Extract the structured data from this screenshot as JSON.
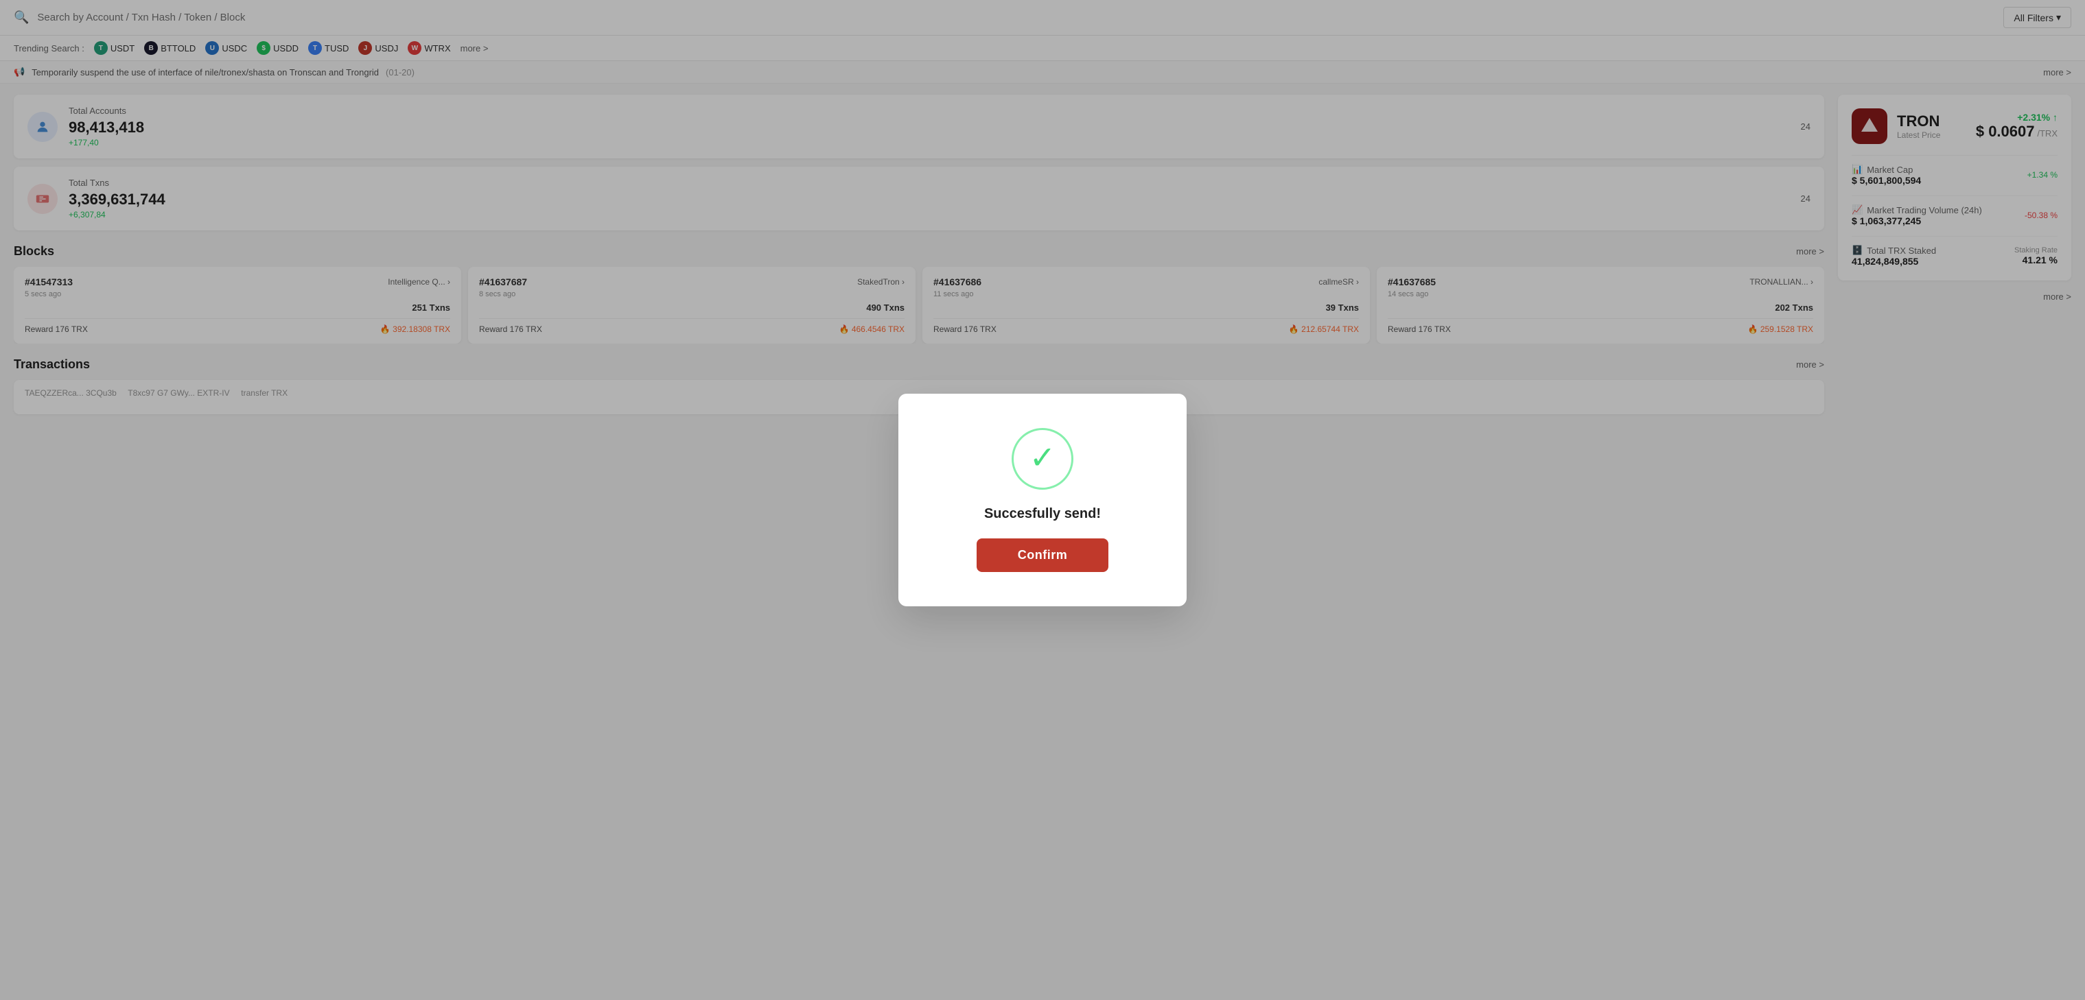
{
  "searchBar": {
    "placeholder": "Search by Account / Txn Hash / Token / Block",
    "filterLabel": "All Filters"
  },
  "trending": {
    "label": "Trending Search :",
    "tokens": [
      {
        "name": "USDT",
        "color": "#26a17b"
      },
      {
        "name": "BTTOLD",
        "color": "#1a1a2e"
      },
      {
        "name": "USDC",
        "color": "#2775ca"
      },
      {
        "name": "USDD",
        "color": "#22c55e"
      },
      {
        "name": "TUSD",
        "color": "#3b82f6"
      },
      {
        "name": "USDJ",
        "color": "#c0392b"
      },
      {
        "name": "WTRX",
        "color": "#e53e3e"
      }
    ],
    "moreLabel": "more >"
  },
  "announcement": {
    "text": "Temporarily suspend the use of interface of nile/tronex/shasta on Tronscan and Trongrid",
    "date": "(01-20)",
    "moreLabel": "more >"
  },
  "stats": {
    "totalAccounts": {
      "label": "Total Accounts",
      "value": "98,413,418",
      "change": "+177,40",
      "right": "24"
    },
    "totalTxns": {
      "label": "Total Txns",
      "value": "3,369,631,744",
      "change": "+6,307,84",
      "right": "24"
    }
  },
  "blocks": {
    "sectionTitle": "Blocks",
    "moreLabel": "more >",
    "items": [
      {
        "number": "#41547313",
        "miner": "Intelligence Q...",
        "time": "5 secs ago",
        "txns": "251 Txns",
        "reward": "Reward 176 TRX",
        "burn": "392.18308 TRX"
      },
      {
        "number": "#41637687",
        "miner": "StakedTron",
        "time": "8 secs ago",
        "txns": "490 Txns",
        "reward": "Reward 176 TRX",
        "burn": "466.4546 TRX"
      },
      {
        "number": "#41637686",
        "miner": "callmeSR",
        "time": "11 secs ago",
        "txns": "39 Txns",
        "reward": "Reward 176 TRX",
        "burn": "212.65744 TRX"
      },
      {
        "number": "#41637685",
        "miner": "TRONALLIAN...",
        "time": "14 secs ago",
        "txns": "202 Txns",
        "reward": "Reward 176 TRX",
        "burn": "259.1528 TRX"
      }
    ]
  },
  "transactions": {
    "sectionTitle": "Transactions",
    "moreLabel": "more >"
  },
  "tron": {
    "name": "TRON",
    "subtitle": "Latest Price",
    "priceChange": "+2.31% ↑",
    "priceValue": "$ 0.0607",
    "priceUnit": "/TRX",
    "stats": [
      {
        "label": "Market Cap",
        "value": "$ 5,601,800,594",
        "change": "+1.34 %",
        "changeType": "positive"
      },
      {
        "label": "Market Trading Volume (24h)",
        "value": "$ 1,063,377,245",
        "change": "-50.38 %",
        "changeType": "negative"
      },
      {
        "label": "Total TRX Staked",
        "value": "41,824,849,855",
        "extraLabel": "Staking Rate",
        "extraValue": "41.21 %"
      }
    ],
    "moreLabel": "more >"
  },
  "modal": {
    "successMessage": "Succesfully send!",
    "confirmLabel": "Confirm"
  }
}
